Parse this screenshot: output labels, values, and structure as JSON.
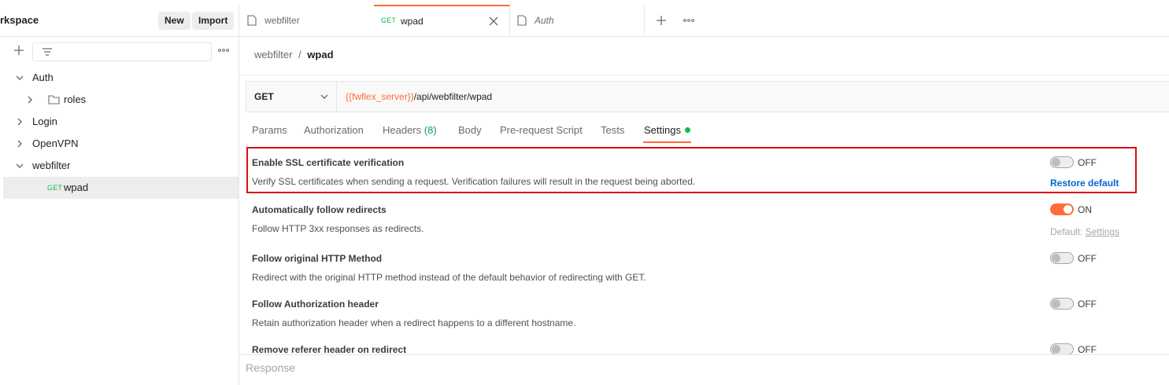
{
  "sidebar": {
    "workspace_title": "rkspace",
    "new_label": "New",
    "import_label": "Import",
    "tree": [
      {
        "label": "Auth"
      },
      {
        "label": "roles"
      },
      {
        "label": "Login"
      },
      {
        "label": "OpenVPN"
      },
      {
        "label": "webfilter"
      },
      {
        "label": "wpad",
        "method": "GET"
      }
    ]
  },
  "tabs": [
    {
      "label": "webfilter"
    },
    {
      "label": "wpad",
      "method": "GET"
    },
    {
      "label": "Auth"
    }
  ],
  "breadcrumb": {
    "parent": "webfilter",
    "separator": "/",
    "current": "wpad"
  },
  "request": {
    "method": "GET",
    "url_variable": "{{fwflex_server}}",
    "url_path": "/api/webfilter/wpad"
  },
  "subtabs": {
    "params": "Params",
    "authorization": "Authorization",
    "headers": "Headers",
    "headers_count": "(8)",
    "body": "Body",
    "prerequest": "Pre-request Script",
    "tests": "Tests",
    "settings": "Settings"
  },
  "settings": [
    {
      "title": "Enable SSL certificate verification",
      "description": "Verify SSL certificates when sending a request. Verification failures will result in the request being aborted.",
      "state": "OFF",
      "restore_label": "Restore default"
    },
    {
      "title": "Automatically follow redirects",
      "description": "Follow HTTP 3xx responses as redirects.",
      "state": "ON",
      "default_prefix": "Default:",
      "default_link": "Settings"
    },
    {
      "title": "Follow original HTTP Method",
      "description": "Redirect with the original HTTP method instead of the default behavior of redirecting with GET.",
      "state": "OFF"
    },
    {
      "title": "Follow Authorization header",
      "description": "Retain authorization header when a redirect happens to a different hostname.",
      "state": "OFF"
    },
    {
      "title": "Remove referer header on redirect",
      "state": "OFF"
    }
  ],
  "response": {
    "label": "Response"
  },
  "colors": {
    "accent": "#ff6c37",
    "highlight_border": "#dd0f0f",
    "link": "#0265d2",
    "get_method": "#0cbb52"
  }
}
